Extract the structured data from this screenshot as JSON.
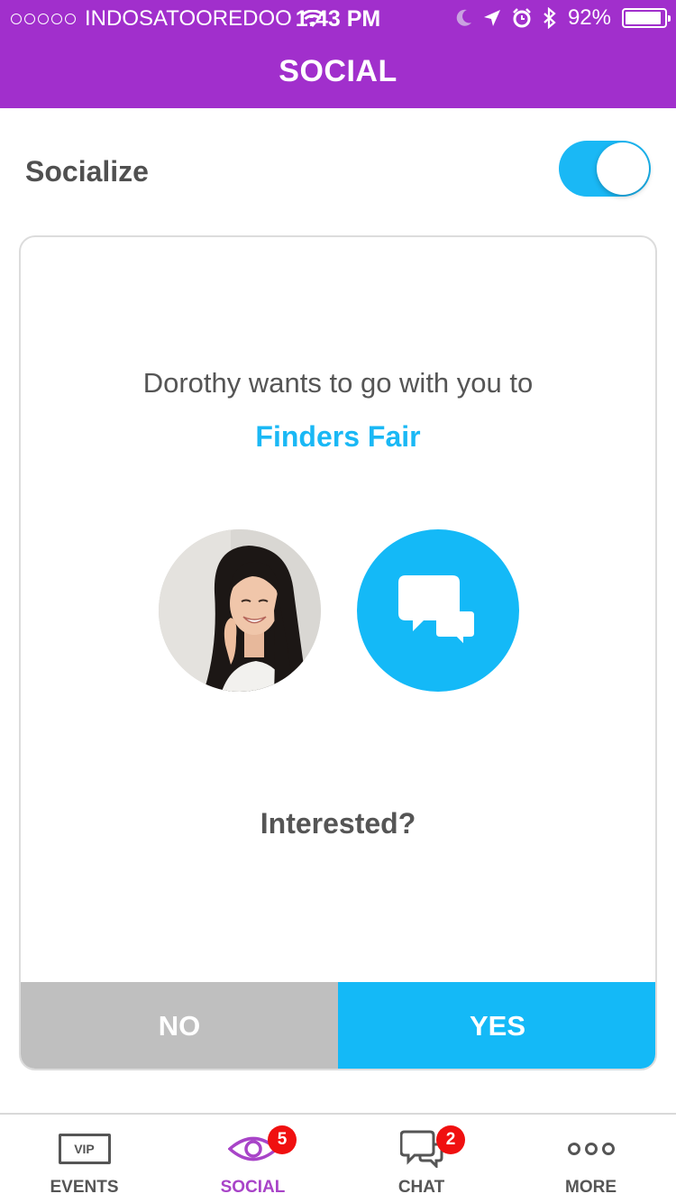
{
  "status_bar": {
    "carrier": "INDOSATOOREDOO",
    "time": "1:43 PM",
    "battery": "92%",
    "battery_level": 0.92,
    "icons": [
      "signal-dots-icon",
      "wifi-icon",
      "moon-icon",
      "location-arrow-icon",
      "alarm-icon",
      "bluetooth-icon",
      "battery-icon"
    ]
  },
  "header": {
    "title": "SOCIAL"
  },
  "socialize": {
    "label": "Socialize",
    "enabled": true
  },
  "card": {
    "invite_text": "Dorothy wants to go with you to",
    "event_name": "Finders Fair",
    "question": "Interested?",
    "no_label": "NO",
    "yes_label": "YES"
  },
  "tabs": [
    {
      "label": "EVENTS",
      "icon": "vip-ticket-icon",
      "icon_text": "VIP",
      "badge": null,
      "active": false
    },
    {
      "label": "SOCIAL",
      "icon": "eye-icon",
      "badge": "5",
      "active": true
    },
    {
      "label": "CHAT",
      "icon": "chat-bubbles-icon",
      "badge": "2",
      "active": false
    },
    {
      "label": "MORE",
      "icon": "more-dots-icon",
      "badge": null,
      "active": false
    }
  ],
  "colors": {
    "header_bg": "#a12fcc",
    "accent_blue": "#14b9f7",
    "no_button": "#bfbfbf",
    "active_tab": "#a844c8",
    "badge": "#f01010"
  }
}
